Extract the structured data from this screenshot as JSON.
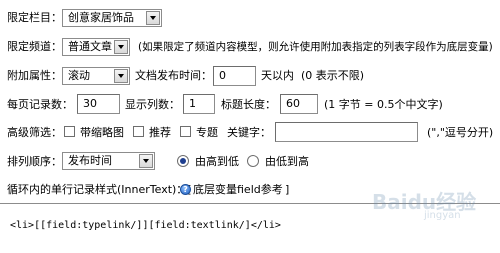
{
  "column": {
    "label": "限定栏目：",
    "value": "创意家居饰品"
  },
  "channel": {
    "label": "限定频道：",
    "value": "普通文章",
    "note": "(如果限定了频道内容模型，则允许使用附加表指定的列表字段作为底层变量)"
  },
  "attr": {
    "label": "附加属性：",
    "value": "滚动",
    "time_label": "文档发布时间：",
    "time_value": "0",
    "time_unit": "天以内",
    "time_note": "(0 表示不限)"
  },
  "rows": {
    "label": "每页记录数：",
    "value": "30",
    "cols_label": "显示列数：",
    "cols_value": "1",
    "title_label": "标题长度：",
    "title_value": "60",
    "title_note": "(1 字节 = 0.5个中文字)"
  },
  "filter": {
    "label": "高级筛选：",
    "thumb": "带缩略图",
    "recommend": "推荐",
    "special": "专题",
    "keyword_label": "关键字：",
    "keyword_value": "",
    "keyword_note": "(\",\"逗号分开)"
  },
  "sort": {
    "label": "排列顺序：",
    "value": "发布时间",
    "desc": "由高到低",
    "asc": "由低到高"
  },
  "innertext": {
    "label": "循环内的单行记录样式(InnerText)：[",
    "help_link": "底层变量field参考",
    "close": "]",
    "code": "<li>[[field:typelink/]][field:textlink/]</li>"
  },
  "watermark": {
    "text": "Baidu经验",
    "sub": "jingyan"
  }
}
